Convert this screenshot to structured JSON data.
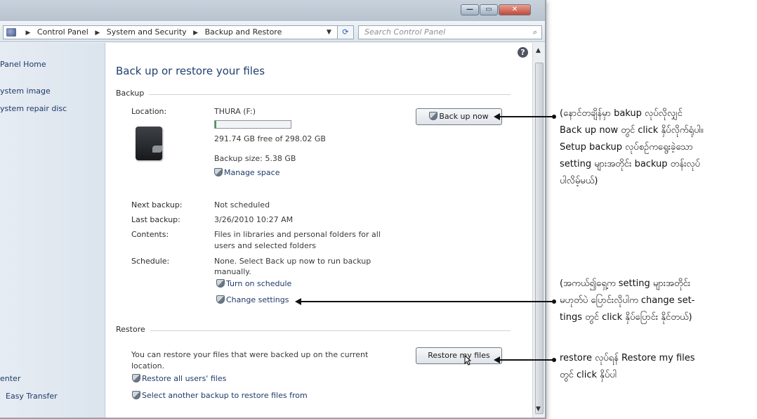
{
  "window": {
    "buttons": {
      "minimize": "—",
      "maximize": "▭",
      "close": "✕"
    }
  },
  "address": {
    "breadcrumb": [
      "Control Panel",
      "System and Security",
      "Backup and Restore"
    ],
    "search_placeholder": "Search Control Panel"
  },
  "nav": {
    "items": [
      "Panel Home",
      "ystem image",
      "ystem repair disc",
      "enter",
      "Easy Transfer"
    ]
  },
  "main": {
    "title": "Back up or restore your files",
    "backup_section": "Backup",
    "location_label": "Location:",
    "location_value": "THURA (F:)",
    "free_space": "291.74 GB free of 298.02 GB",
    "disk_used_fraction": 0.021,
    "backup_size": "Backup size: 5.38 GB",
    "manage_space": "Manage space",
    "back_up_now": "Back up now",
    "next_backup_label": "Next backup:",
    "next_backup_value": "Not scheduled",
    "last_backup_label": "Last backup:",
    "last_backup_value": "3/26/2010 10:27 AM",
    "contents_label": "Contents:",
    "contents_value_1": "Files in libraries and personal folders for all",
    "contents_value_2": "users and selected folders",
    "schedule_label": "Schedule:",
    "schedule_value_1": "None. Select Back up now to run backup",
    "schedule_value_2": "manually.",
    "turn_on_schedule": "Turn on schedule",
    "change_settings": "Change settings",
    "restore_section": "Restore",
    "restore_text_1": "You can restore your files that were backed up on the current",
    "restore_text_2": "location.",
    "restore_my_files": "Restore my files",
    "restore_all_users": "Restore all users' files",
    "select_another_backup": "Select another backup to restore files from"
  },
  "annotations": {
    "note1": "(နောင်တချိန်မှာ bakup လုပ်လိုလျှင်\nBack up now တွင် click နှိပ်လိုက်ရုံပါ။\nSetup backup လုပ်စဉ်ကရွေးခဲ့သော\nsetting များအတိုင်း backup တန်းလုပ်\nပါလိမ့်မယ်)",
    "note2": "(အကယ်၍ရှေ့က setting များအတိုင်း\nမဟုတ်ပဲ ပြောင်းလိုပါက change set-\ntings တွင် click နှိပ်ပြောင်း နိုင်တယ်)",
    "note3": "restore လုပ်ရန် Restore my files\nတွင် click နှိပ်ပါ"
  }
}
